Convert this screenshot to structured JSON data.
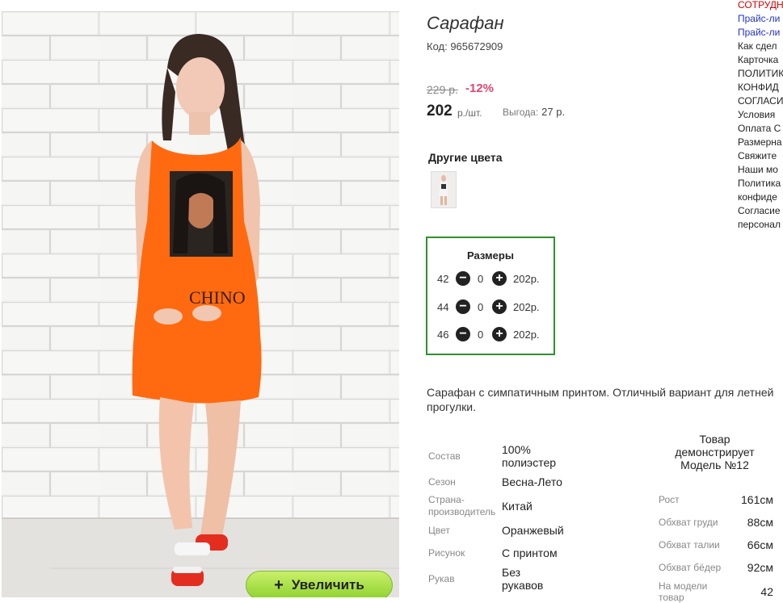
{
  "product": {
    "title": "Сарафан",
    "code": "Код: 965672909",
    "old_price": "229 р.",
    "discount": "-12%",
    "price": "202",
    "price_unit": "р./шт.",
    "benefit_label": "Выгода:",
    "benefit_value": "27 р."
  },
  "photo": {
    "zoom_icon": "plus-icon",
    "zoom_label": "Увеличить",
    "print_text": "CHINO"
  },
  "other_colors": {
    "title": "Другие цвета"
  },
  "sizes": {
    "title": "Размеры",
    "rows": [
      {
        "size": "42",
        "qty": "0",
        "price": "202р."
      },
      {
        "size": "44",
        "qty": "0",
        "price": "202р."
      },
      {
        "size": "46",
        "qty": "0",
        "price": "202р."
      }
    ],
    "minus_icon": "−",
    "plus_icon": "+"
  },
  "description": "Сарафан с симпатичным принтом. Отличный вариант для летней прогулки.",
  "attributes": [
    {
      "label": "Состав",
      "value": "100% полиэстер"
    },
    {
      "label": "Сезон",
      "value": "Весна-Лето"
    },
    {
      "label": "Страна-производитель",
      "value": "Китай"
    },
    {
      "label": "Цвет",
      "value": "Оранжевый"
    },
    {
      "label": "Рисунок",
      "value": "С принтом"
    },
    {
      "label": "Рукав",
      "value": "Без рукавов"
    }
  ],
  "model": {
    "heading": "Товар демонстрирует Модель №12",
    "params": [
      {
        "label": "Рост",
        "value": "161см"
      },
      {
        "label": "Обхват груди",
        "value": "88см"
      },
      {
        "label": "Обхват талии",
        "value": "66см"
      },
      {
        "label": "Обхват бёдер",
        "value": "92см"
      },
      {
        "label": "На модели товар",
        "value": "42"
      }
    ]
  },
  "side_links": [
    {
      "text": "СОТРУДН",
      "color": "#d40000"
    },
    {
      "text": "Прайс-ли",
      "color": "#2233cc"
    },
    {
      "text": "Прайс-ли",
      "color": "#2233cc"
    },
    {
      "text": "Как сдел",
      "color": "#222222"
    },
    {
      "text": "Карточка",
      "color": "#222222"
    },
    {
      "text": "ПОЛИТИК",
      "color": "#222222"
    },
    {
      "text": "КОНФИД",
      "color": "#222222"
    },
    {
      "text": "СОГЛАСИ",
      "color": "#222222"
    },
    {
      "text": "Условия",
      "color": "#222222"
    },
    {
      "text": "Оплата С",
      "color": "#222222"
    },
    {
      "text": "Размерна",
      "color": "#222222"
    },
    {
      "text": "Свяжите",
      "color": "#222222"
    },
    {
      "text": "Наши мо",
      "color": "#222222"
    },
    {
      "text": "Политика",
      "color": "#222222"
    },
    {
      "text": "конфиде",
      "color": "#222222"
    },
    {
      "text": "Согласие",
      "color": "#222222"
    },
    {
      "text": "персонал",
      "color": "#222222"
    }
  ]
}
